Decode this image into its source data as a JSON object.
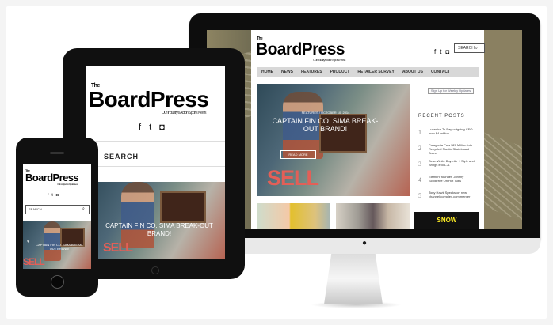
{
  "brand": {
    "name": "BoardPress",
    "prefix": "The",
    "tagline": "Our Industry's Action Sports News"
  },
  "navigation": [
    "HOME",
    "NEWS",
    "FEATURES",
    "PRODUCT",
    "RETAILER SURVEY",
    "ABOUT US",
    "CONTACT"
  ],
  "search": {
    "placeholder": "SEARCH",
    "ipad": "SEARCH"
  },
  "hero": {
    "meta": "FEATURES / OCTOBER 10, 2014",
    "title": "CAPTAIN FIN CO. SIMA BREAK-OUT BRAND!",
    "button": "READ MORE"
  },
  "sidebar": {
    "newsletter": "Sign Up for Weekly Updates",
    "recent_title": "RECENT POSTS",
    "posts": [
      {
        "number": "1",
        "title": "Lusenica To Pay outgoing CEO over $4 million"
      },
      {
        "number": "2",
        "title": "Patagonia Puts $20 Million Into Recycled Plastic Skateboard Brand"
      },
      {
        "number": "3",
        "title": "Sean White Buys Air + Style and Brings it to L.A."
      },
      {
        "number": "4",
        "title": "Element founder, Johnny Schillereff On Hot Tubs"
      },
      {
        "number": "5",
        "title": "Tony Hawk Speaks on new channel/complex.com merger"
      }
    ],
    "ad": "SNOW"
  },
  "icons": [
    "facebook-icon",
    "twitter-icon",
    "instagram-icon",
    "search-icon",
    "apple-icon"
  ],
  "colors": {
    "brand": "#111111",
    "accent": "#e35f57",
    "device": "#101010"
  }
}
